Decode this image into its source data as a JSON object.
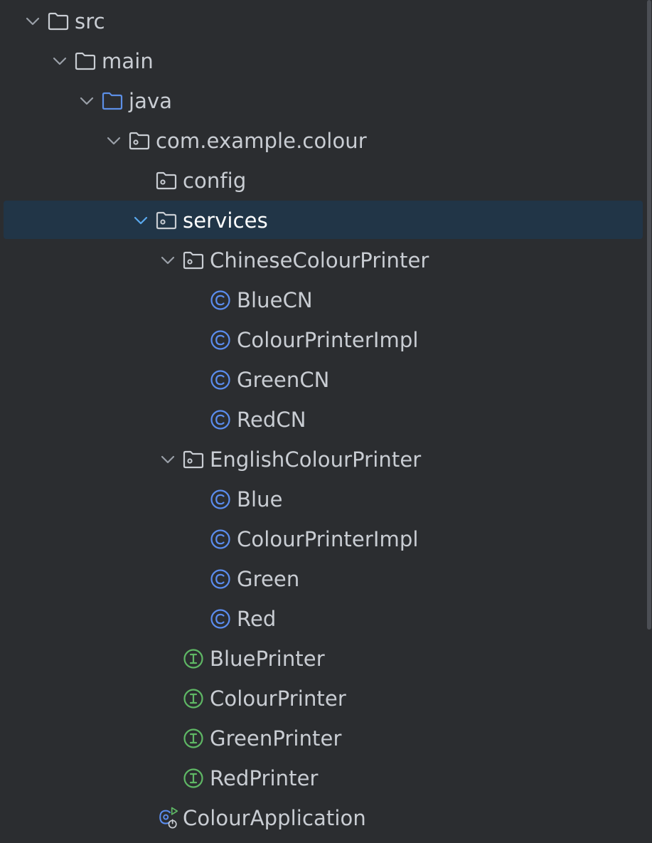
{
  "colors": {
    "background": "#2b2d30",
    "selection": "#213547",
    "text": "#c9cdd3",
    "selected_text": "#ffffff",
    "chevron": "#9aa0a8",
    "chevron_selected": "#5aa9ee",
    "folder": "#c9cdd3",
    "source_folder": "#5c8fe6",
    "class_icon": "#5b8def",
    "interface_icon": "#5fb865",
    "run_badge": "#5fb865"
  },
  "tree": {
    "items": [
      {
        "label": "src",
        "depth": 0,
        "expanded": true,
        "icon": "folder-icon"
      },
      {
        "label": "main",
        "depth": 1,
        "expanded": true,
        "icon": "folder-icon"
      },
      {
        "label": "java",
        "depth": 2,
        "expanded": true,
        "icon": "source-folder-icon"
      },
      {
        "label": "com.example.colour",
        "depth": 3,
        "expanded": true,
        "icon": "package-icon"
      },
      {
        "label": "config",
        "depth": 4,
        "icon": "package-icon"
      },
      {
        "label": "services",
        "depth": 4,
        "expanded": true,
        "icon": "package-icon",
        "selected": true
      },
      {
        "label": "ChineseColourPrinter",
        "depth": 5,
        "expanded": true,
        "icon": "package-icon"
      },
      {
        "label": "BlueCN",
        "depth": 6,
        "icon": "class-icon"
      },
      {
        "label": "ColourPrinterImpl",
        "depth": 6,
        "icon": "class-icon"
      },
      {
        "label": "GreenCN",
        "depth": 6,
        "icon": "class-icon"
      },
      {
        "label": "RedCN",
        "depth": 6,
        "icon": "class-icon"
      },
      {
        "label": "EnglishColourPrinter",
        "depth": 5,
        "expanded": true,
        "icon": "package-icon"
      },
      {
        "label": "Blue",
        "depth": 6,
        "icon": "class-icon"
      },
      {
        "label": "ColourPrinterImpl",
        "depth": 6,
        "icon": "class-icon"
      },
      {
        "label": "Green",
        "depth": 6,
        "icon": "class-icon"
      },
      {
        "label": "Red",
        "depth": 6,
        "icon": "class-icon"
      },
      {
        "label": "BluePrinter",
        "depth": 5,
        "icon": "interface-icon"
      },
      {
        "label": "ColourPrinter",
        "depth": 5,
        "icon": "interface-icon"
      },
      {
        "label": "GreenPrinter",
        "depth": 5,
        "icon": "interface-icon"
      },
      {
        "label": "RedPrinter",
        "depth": 5,
        "icon": "interface-icon"
      },
      {
        "label": "ColourApplication",
        "depth": 4,
        "icon": "spring-boot-app-icon"
      }
    ]
  }
}
